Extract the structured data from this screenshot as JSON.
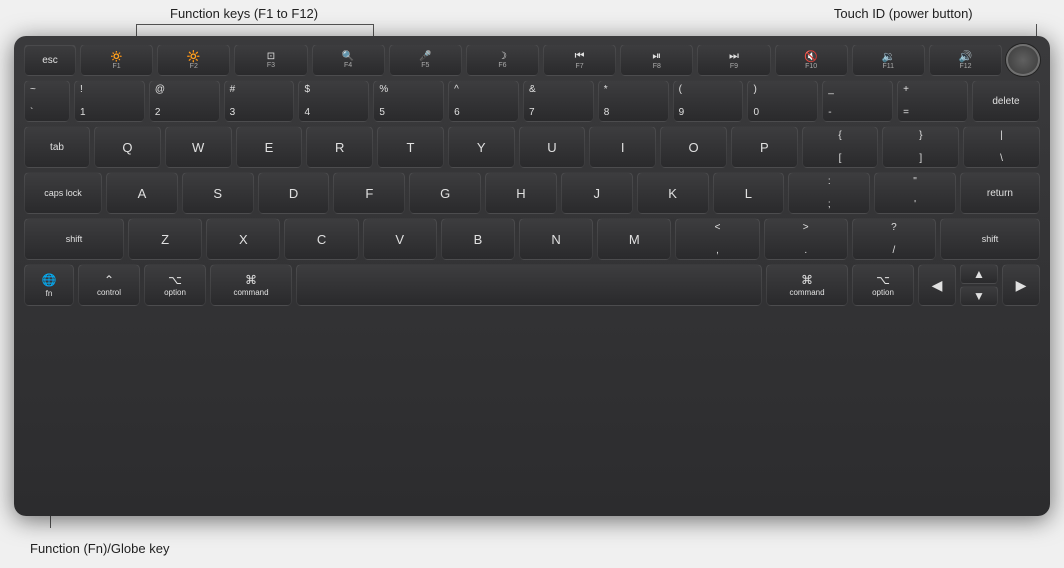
{
  "annotations": {
    "fn_keys_label": "Function keys (F1 to F12)",
    "touchid_label": "Touch ID (power button)",
    "globe_label": "Function (Fn)/Globe key"
  },
  "keyboard": {
    "rows": {
      "fn_row": [
        {
          "id": "esc",
          "primary": "esc",
          "secondary": ""
        },
        {
          "id": "f1",
          "primary": "☀",
          "secondary": "F1"
        },
        {
          "id": "f2",
          "primary": "☀",
          "secondary": "F2"
        },
        {
          "id": "f3",
          "primary": "⊞",
          "secondary": "F3"
        },
        {
          "id": "f4",
          "primary": "🔍",
          "secondary": "F4"
        },
        {
          "id": "f5",
          "primary": "🎤",
          "secondary": "F5"
        },
        {
          "id": "f6",
          "primary": "☾",
          "secondary": "F6"
        },
        {
          "id": "f7",
          "primary": "⏮",
          "secondary": "F7"
        },
        {
          "id": "f8",
          "primary": "⏯",
          "secondary": "F8"
        },
        {
          "id": "f9",
          "primary": "⏭",
          "secondary": "F9"
        },
        {
          "id": "f10",
          "primary": "🔇",
          "secondary": "F10"
        },
        {
          "id": "f11",
          "primary": "🔉",
          "secondary": "F11"
        },
        {
          "id": "f12",
          "primary": "🔊",
          "secondary": "F12"
        }
      ],
      "num_row": [
        "~`",
        "!1",
        "@2",
        "#3",
        "$4",
        "%5",
        "^6",
        "&7",
        "*8",
        "(9",
        ")0",
        "_-",
        "+="
      ],
      "qwerty_row": [
        "Q",
        "W",
        "E",
        "R",
        "T",
        "Y",
        "U",
        "I",
        "O",
        "P",
        "{[",
        "]}",
        "|\\ "
      ],
      "asdf_row": [
        "A",
        "S",
        "D",
        "F",
        "G",
        "H",
        "J",
        "K",
        "L",
        ":;",
        "\"'"
      ],
      "zxcv_row": [
        "Z",
        "X",
        "C",
        "V",
        "B",
        "N",
        "M",
        "<,",
        ">.",
        "?/"
      ]
    }
  }
}
